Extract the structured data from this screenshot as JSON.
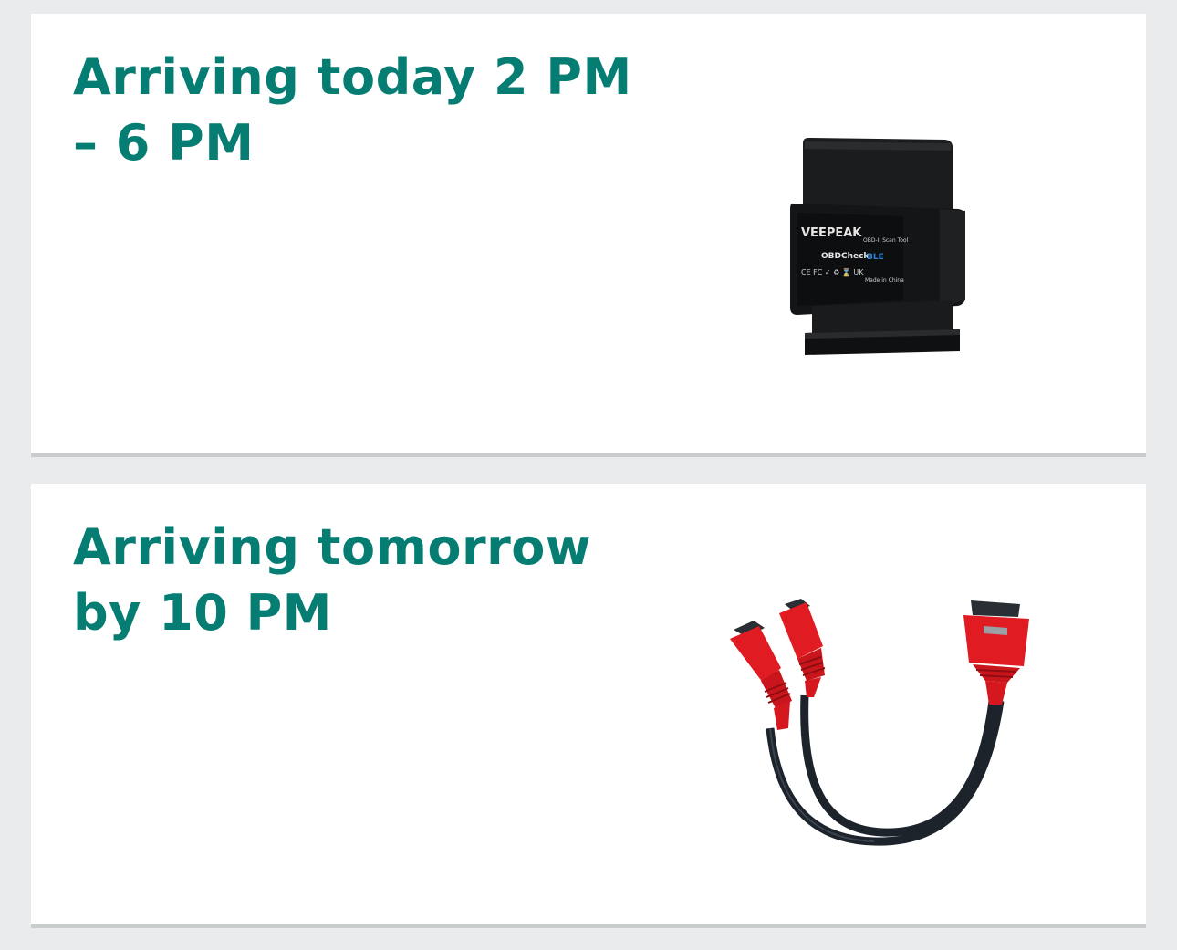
{
  "deliveries": [
    {
      "heading": "Arriving today 2 PM – 6 PM",
      "product": {
        "icon": "obd2-scanner-image",
        "brand": "VEEPEAK",
        "model_text": "OBDCheck",
        "model_suffix": "BLE",
        "type_text": "OBD-II Scan Tool",
        "cert_text": "CE FC ✓ ♻ ⌛ UK",
        "origin_text": "Made in China"
      }
    },
    {
      "heading": "Arriving tomorrow by 10 PM",
      "product": {
        "icon": "obd-y-splitter-cable-image",
        "colors": {
          "connector": "#e01b22",
          "cable": "#1c232b"
        }
      }
    }
  ],
  "colors": {
    "heading": "#067d72",
    "background": "#e9ebec",
    "card": "#ffffff",
    "card_border": "#c9cccd"
  }
}
